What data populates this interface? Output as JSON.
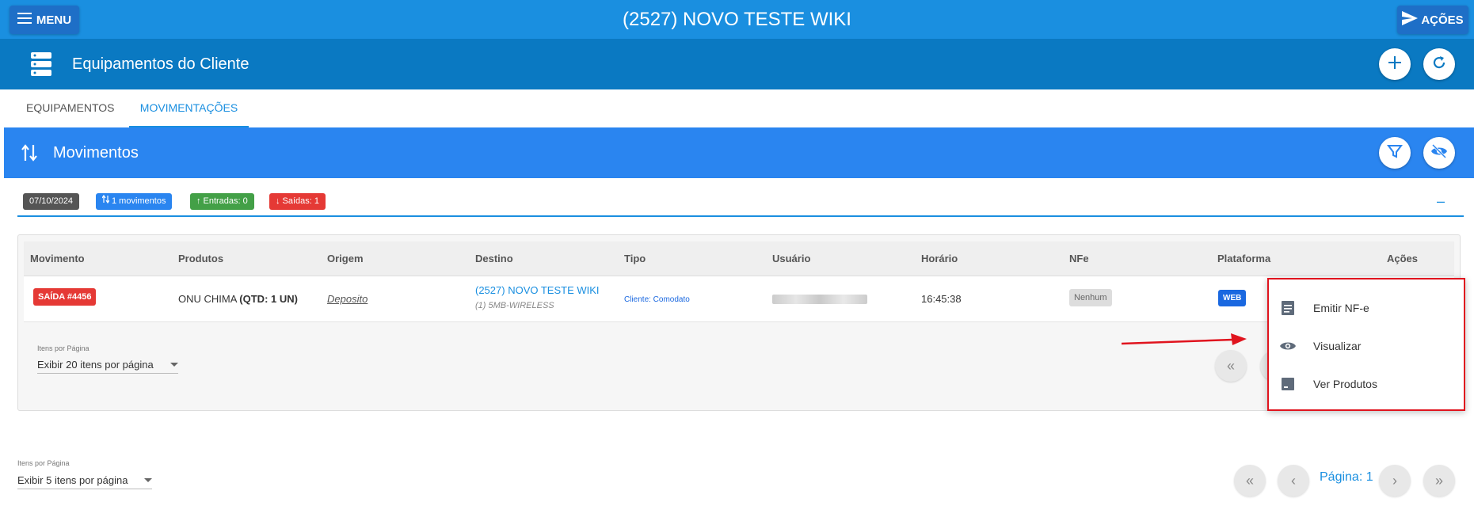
{
  "topbar": {
    "menu_label": "MENU",
    "title": "(2527) NOVO TESTE WIKI",
    "acoes_label": "AÇÕES"
  },
  "header": {
    "title": "Equipamentos do Cliente"
  },
  "tabs": [
    {
      "label": "EQUIPAMENTOS",
      "active": false
    },
    {
      "label": "MOVIMENTAÇÕES",
      "active": true
    }
  ],
  "panel": {
    "title": "Movimentos"
  },
  "summary": {
    "date": "07/10/2024",
    "movimentos": "1 movimentos",
    "entradas": "Entradas: 0",
    "saidas": "Saídas: 1",
    "collapse_symbol": "–",
    "colors": {
      "date": "#555555",
      "movimentos": "#2a85f0",
      "entradas": "#43a047",
      "saidas": "#e53935"
    }
  },
  "table": {
    "columns": [
      "Movimento",
      "Produtos",
      "Origem",
      "Destino",
      "Tipo",
      "Usuário",
      "Horário",
      "NFe",
      "Plataforma",
      "Ações"
    ],
    "rows": [
      {
        "movimento": "SAÍDA #4456",
        "produto_nome": "ONU CHIMA",
        "produto_qtd": "(QTD: 1 UN)",
        "origem": "Deposito",
        "destino_cliente": "(2527) NOVO TESTE WIKI",
        "destino_plano": "(1) 5MB-WIRELESS",
        "tipo": "Cliente: Comodato",
        "horario": "16:45:38",
        "nfe": "Nenhum",
        "plataforma": "WEB"
      }
    ],
    "items_per_page_label": "Itens por Página",
    "items_per_page_value": "Exibir 20 itens por página"
  },
  "context_menu": {
    "items": [
      {
        "label": "Emitir NF-e",
        "icon": "document-icon"
      },
      {
        "label": "Visualizar",
        "icon": "eye-icon"
      },
      {
        "label": "Ver Produtos",
        "icon": "box-icon"
      }
    ]
  },
  "footer": {
    "items_per_page_label": "Itens por Página",
    "items_per_page_value": "Exibir 5 itens por página",
    "page_label": "Página: 1"
  }
}
